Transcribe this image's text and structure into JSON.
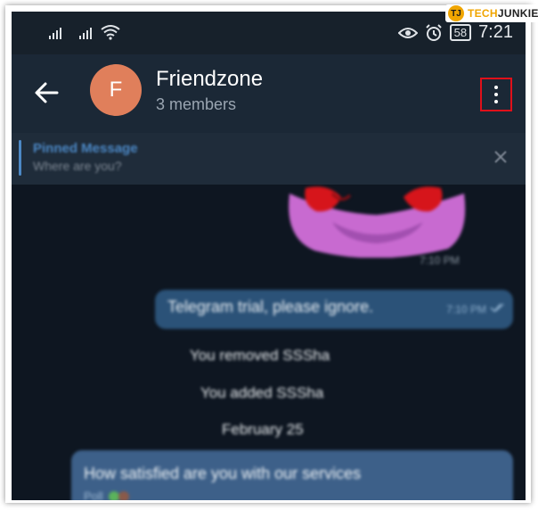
{
  "status_bar": {
    "time": "7:21",
    "battery": "58",
    "icons": [
      "signal-icon",
      "signal-icon",
      "wifi-icon",
      "eye-icon",
      "alarm-icon",
      "battery-icon"
    ]
  },
  "watermark": {
    "brand_part1": "TECH",
    "brand_part2": "JUNKIE"
  },
  "header": {
    "avatar_letter": "F",
    "title": "Friendzone",
    "subtitle": "3 members",
    "menu_icon": "more-vertical-icon",
    "menu_highlight_color": "#e0101a"
  },
  "pinned": {
    "title": "Pinned Message",
    "text": "Where are you?"
  },
  "messages": {
    "sticker_time": "7:10 PM",
    "outgoing_text": "Telegram trial, please ignore.",
    "outgoing_time": "7:10 PM",
    "service_1": "You removed SSSha",
    "service_2": "You added SSSha",
    "date_label": "February 25",
    "poll_question": "How satisfied are you with our services",
    "poll_sub": "Poll"
  },
  "colors": {
    "header_bg": "#1b2836",
    "avatar_bg": "#e07f5b",
    "outgoing_bubble": "#2b5278",
    "chat_bg": "#0e1621"
  }
}
